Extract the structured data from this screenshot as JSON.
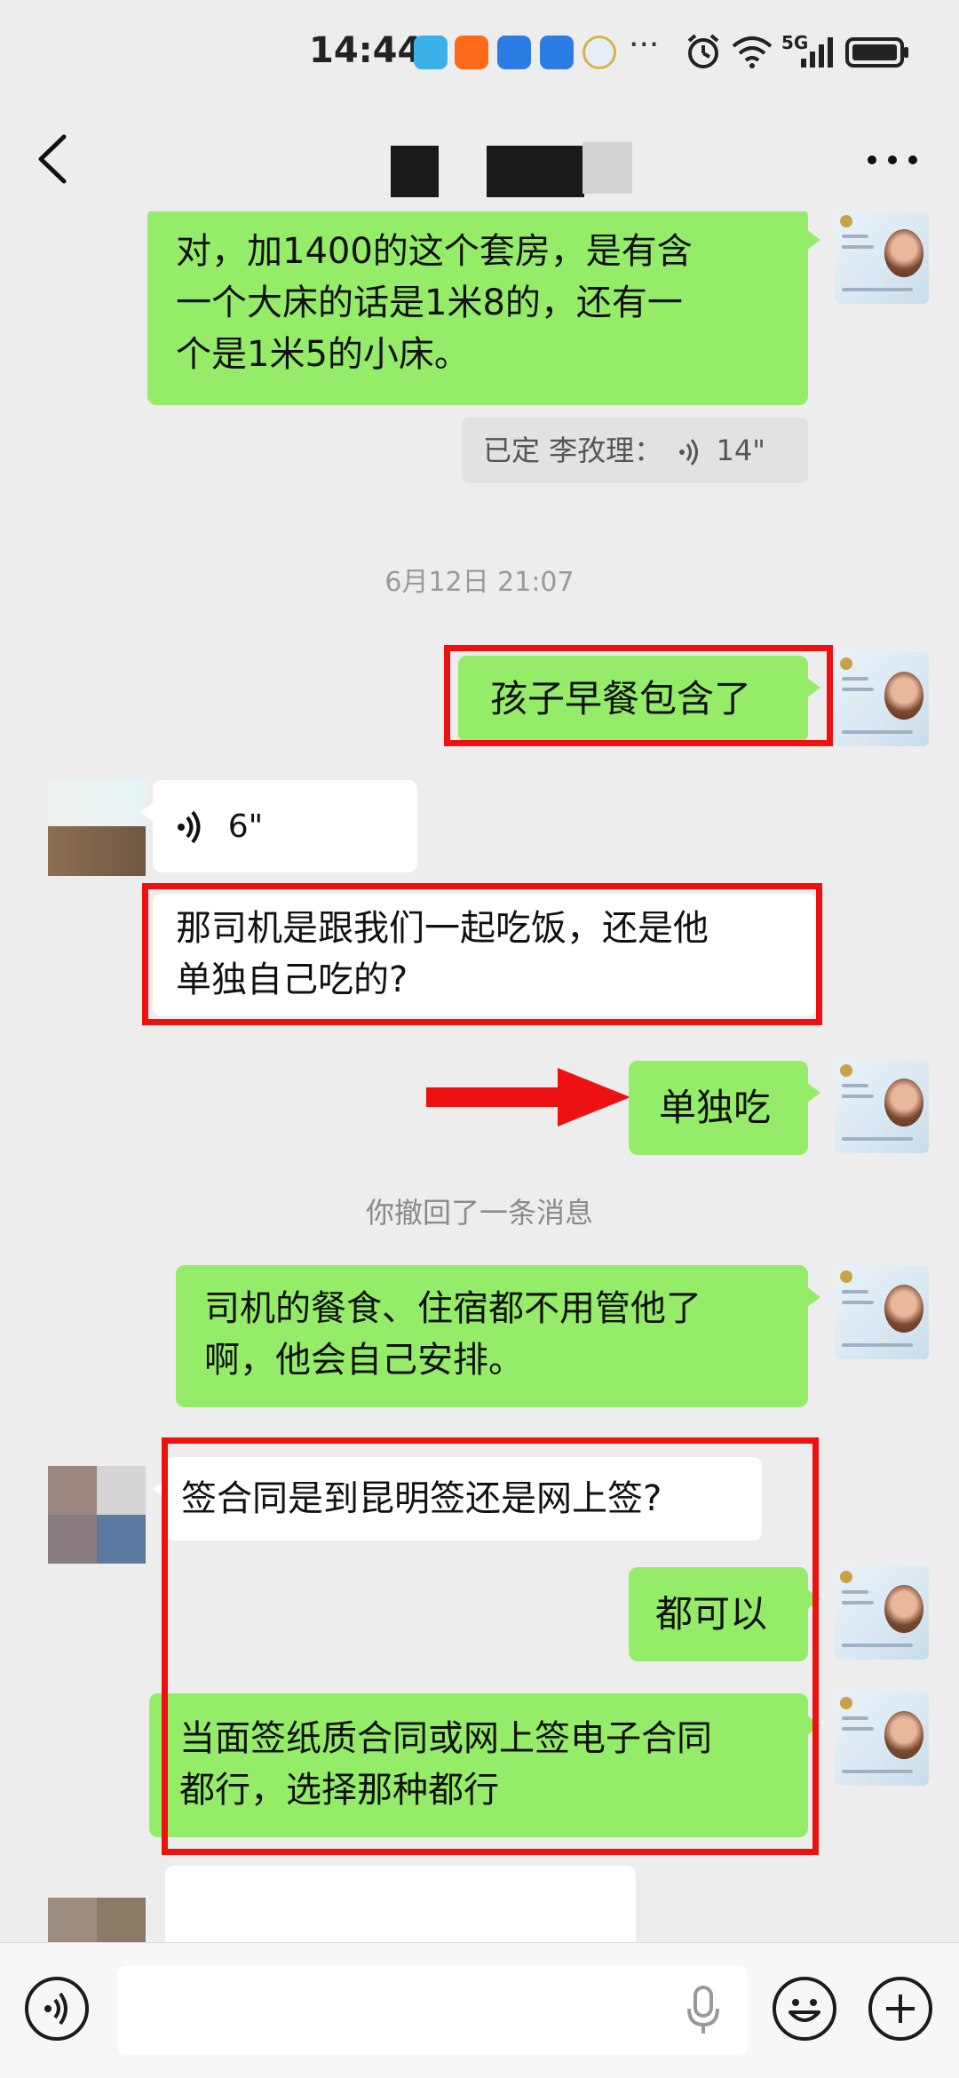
{
  "status_bar": {
    "time": "14:44",
    "signal_label": "5G"
  },
  "header": {
    "title": ""
  },
  "messages": {
    "m1": {
      "lines": [
        "对，加1400的这个套房，是有含",
        "一个大床的话是1米8的，还有一",
        "个是1米5的小床。"
      ]
    },
    "m1_quote": {
      "text": "已定 李孜理：",
      "duration": "14\""
    },
    "timestamp1": "6月12日 21:07",
    "m2": {
      "text": "孩子早餐包含了"
    },
    "m3_voice": {
      "duration": "6\""
    },
    "m4": {
      "lines": [
        "那司机是跟我们一起吃饭，还是他",
        "单独自己吃的?"
      ]
    },
    "m5": {
      "text": "单独吃"
    },
    "recall_notice": "你撤回了一条消息",
    "m6": {
      "lines": [
        "司机的餐食、住宿都不用管他了",
        "啊，他会自己安排。"
      ]
    },
    "m7": {
      "text": "签合同是到昆明签还是网上签?"
    },
    "m8": {
      "text": "都可以"
    },
    "m9": {
      "lines": [
        "当面签纸质合同或网上签电子合同",
        "都行，选择那种都行"
      ]
    }
  },
  "input_bar": {
    "placeholder": ""
  },
  "colors": {
    "green_bubble": "#95ec69",
    "highlight_red": "#ee1111",
    "background": "#ededed"
  },
  "icons": [
    "back-arrow-icon",
    "more-icon",
    "voice-wave-icon",
    "microphone-icon",
    "emoji-icon",
    "plus-icon"
  ]
}
